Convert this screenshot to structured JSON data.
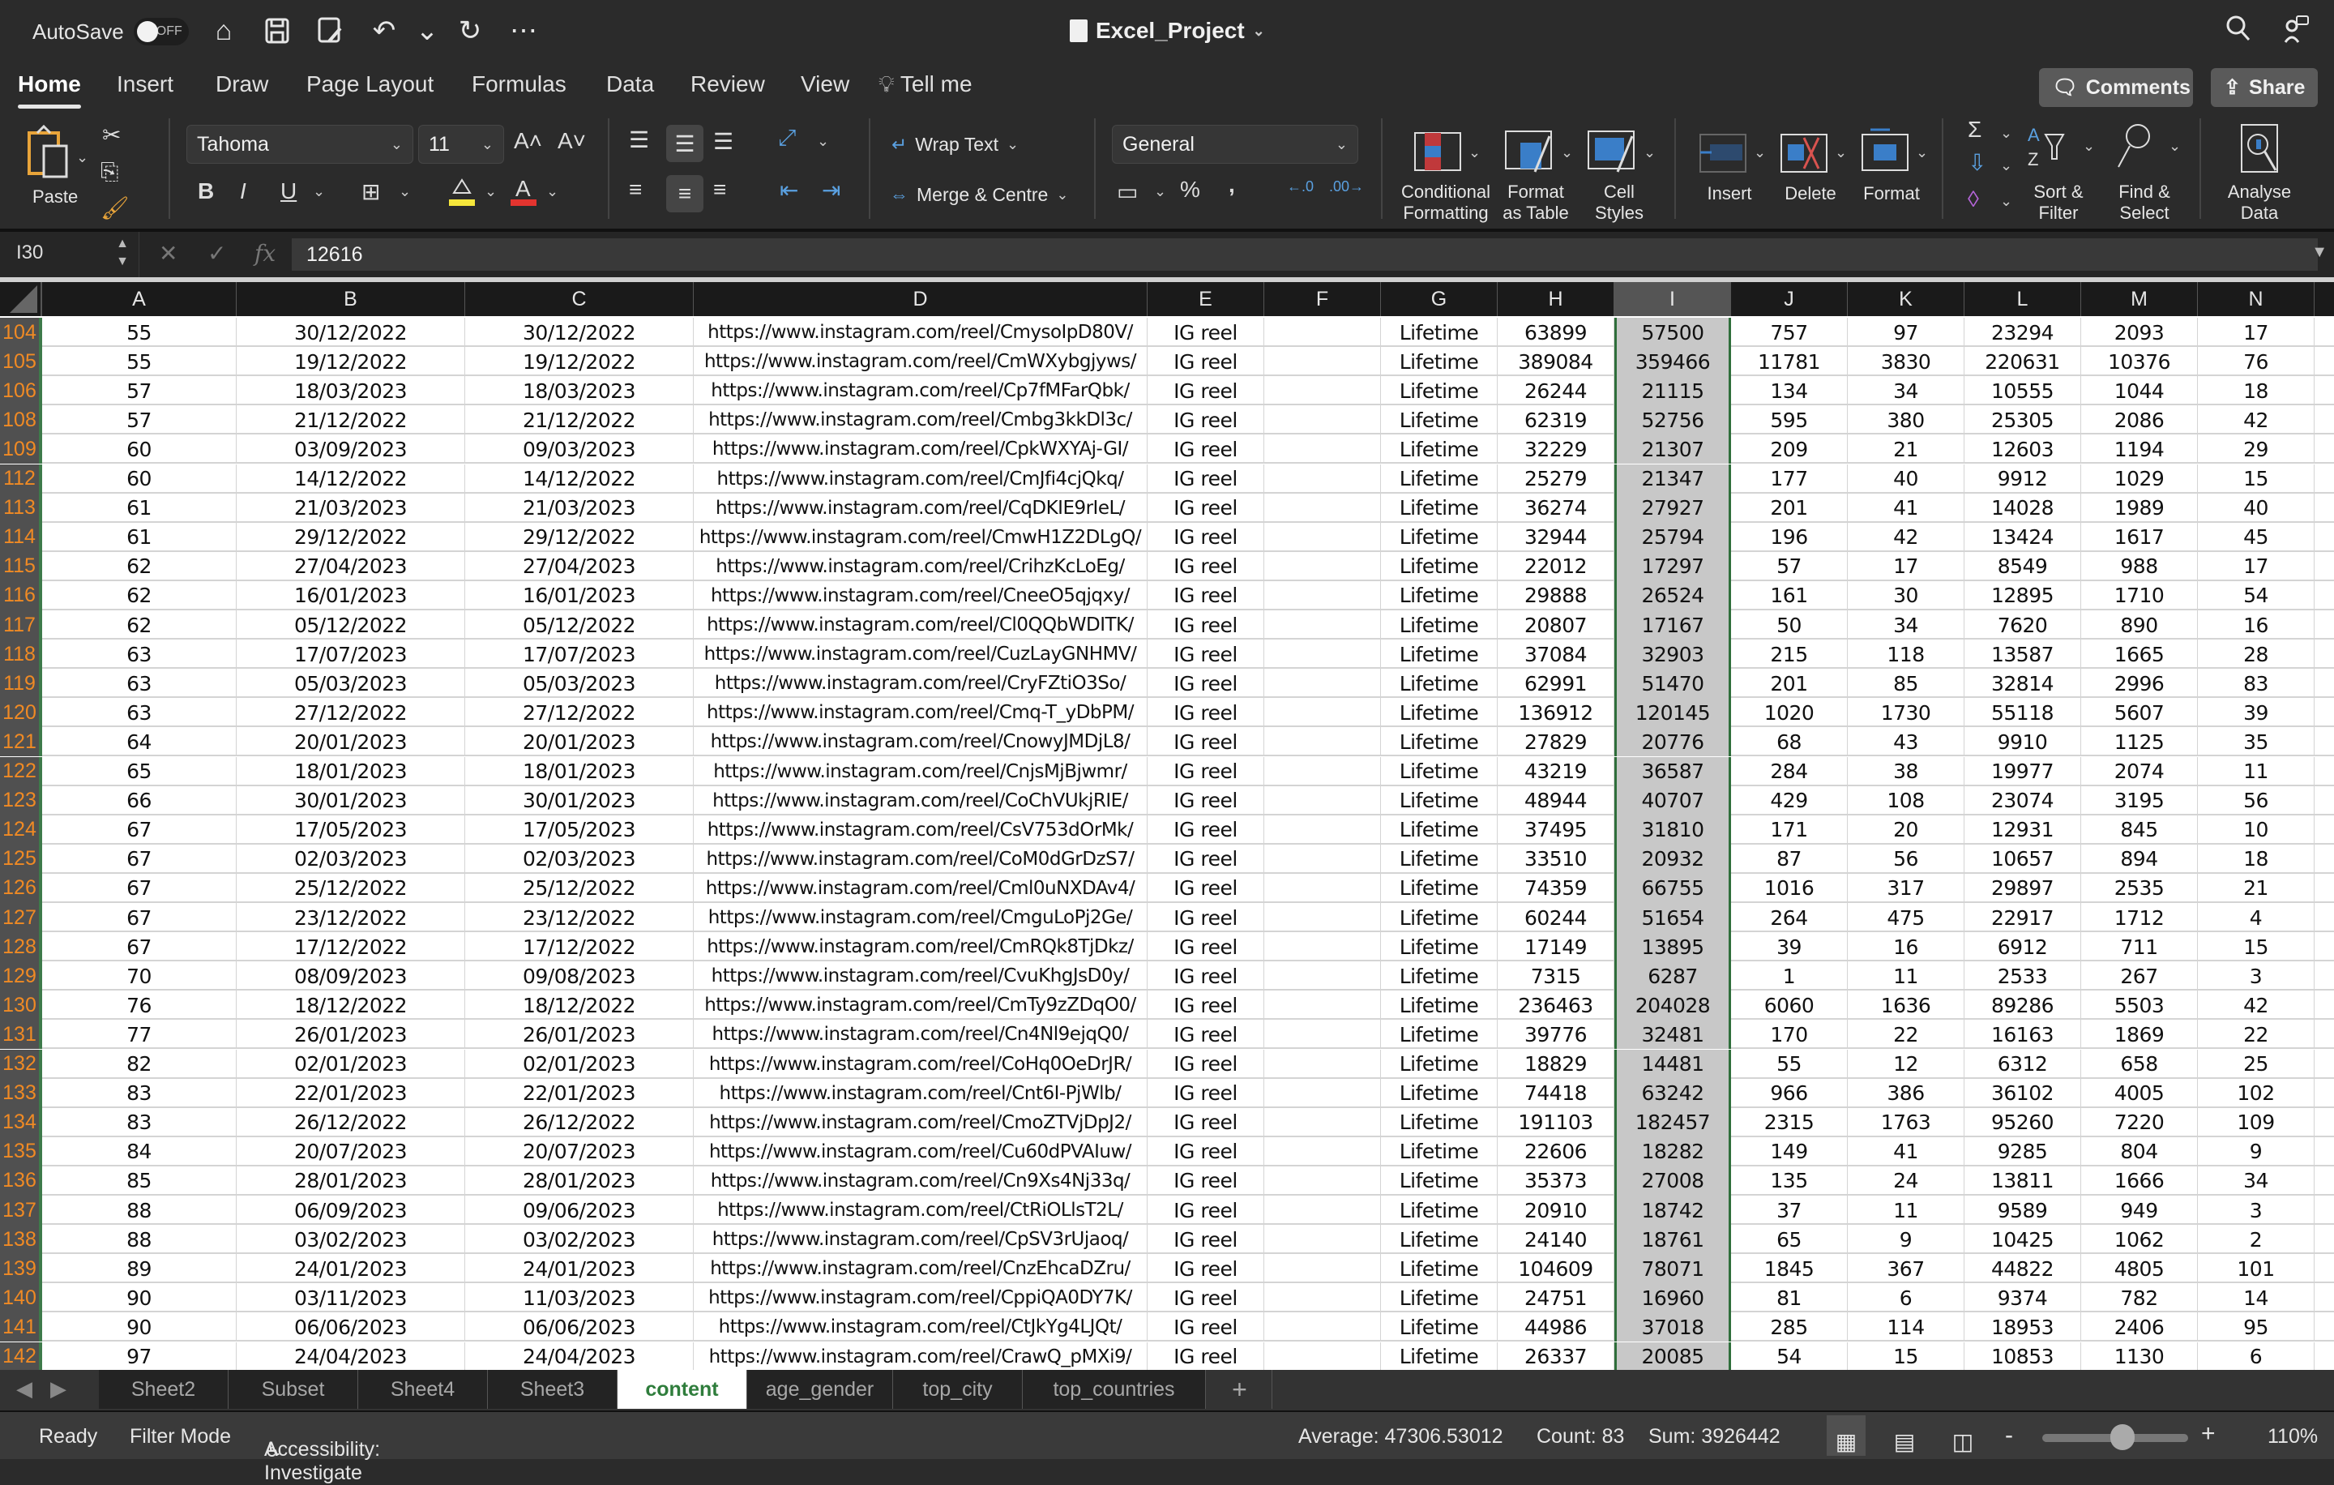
{
  "titlebar": {
    "autosave_label": "AutoSave",
    "autosave_state": "OFF",
    "doc_title": "Excel_Project",
    "qat_icons": [
      "home-icon",
      "save-icon",
      "save-as-icon",
      "undo-icon",
      "redo-icon",
      "more-icon"
    ]
  },
  "ribbon_tabs": [
    "Home",
    "Insert",
    "Draw",
    "Page Layout",
    "Formulas",
    "Data",
    "Review",
    "View"
  ],
  "tell_me": "Tell me",
  "comments_label": "Comments",
  "share_label": "Share",
  "ribbon": {
    "paste_label": "Paste",
    "font_name": "Tahoma",
    "font_size": "11",
    "wrap_text": "Wrap Text",
    "merge_centre": "Merge & Centre",
    "number_format": "General",
    "conditional_formatting": "Conditional Formatting",
    "conditional_formatting_l1": "Conditional",
    "conditional_formatting_l2": "Formatting",
    "format_as_table_l1": "Format",
    "format_as_table_l2": "as Table",
    "cell_styles_l1": "Cell",
    "cell_styles_l2": "Styles",
    "insert": "Insert",
    "delete": "Delete",
    "format": "Format",
    "sort_filter_l1": "Sort &",
    "sort_filter_l2": "Filter",
    "find_select_l1": "Find &",
    "find_select_l2": "Select",
    "analyse_data_l1": "Analyse",
    "analyse_data_l2": "Data",
    "bold": "B",
    "italic": "I",
    "underline": "U",
    "percent": "%",
    "comma": ","
  },
  "formula_bar": {
    "name_box": "I30",
    "formula": "12616"
  },
  "columns": [
    "A",
    "B",
    "C",
    "D",
    "E",
    "F",
    "G",
    "H",
    "I",
    "J",
    "K",
    "L",
    "M",
    "N"
  ],
  "selected_column": "I",
  "rows": [
    {
      "n": "104",
      "c": [
        "55",
        "30/12/2022",
        "30/12/2022",
        "https://www.instagram.com/reel/CmysoIpD80V/",
        "IG reel",
        "",
        "Lifetime",
        "63899",
        "57500",
        "757",
        "97",
        "23294",
        "2093",
        "17"
      ]
    },
    {
      "n": "105",
      "c": [
        "55",
        "19/12/2022",
        "19/12/2022",
        "https://www.instagram.com/reel/CmWXybgjyws/",
        "IG reel",
        "",
        "Lifetime",
        "389084",
        "359466",
        "11781",
        "3830",
        "220631",
        "10376",
        "76"
      ]
    },
    {
      "n": "106",
      "c": [
        "57",
        "18/03/2023",
        "18/03/2023",
        "https://www.instagram.com/reel/Cp7fMFarQbk/",
        "IG reel",
        "",
        "Lifetime",
        "26244",
        "21115",
        "134",
        "34",
        "10555",
        "1044",
        "18"
      ]
    },
    {
      "n": "108",
      "c": [
        "57",
        "21/12/2022",
        "21/12/2022",
        "https://www.instagram.com/reel/Cmbg3kkDl3c/",
        "IG reel",
        "",
        "Lifetime",
        "62319",
        "52756",
        "595",
        "380",
        "25305",
        "2086",
        "42"
      ]
    },
    {
      "n": "109",
      "c": [
        "60",
        "03/09/2023",
        "09/03/2023",
        "https://www.instagram.com/reel/CpkWXYAj-GI/",
        "IG reel",
        "",
        "Lifetime",
        "32229",
        "21307",
        "209",
        "21",
        "12603",
        "1194",
        "29"
      ]
    },
    {
      "n": "112",
      "c": [
        "60",
        "14/12/2022",
        "14/12/2022",
        "https://www.instagram.com/reel/CmJfi4cjQkq/",
        "IG reel",
        "",
        "Lifetime",
        "25279",
        "21347",
        "177",
        "40",
        "9912",
        "1029",
        "15"
      ]
    },
    {
      "n": "113",
      "c": [
        "61",
        "21/03/2023",
        "21/03/2023",
        "https://www.instagram.com/reel/CqDKIE9rIeL/",
        "IG reel",
        "",
        "Lifetime",
        "36274",
        "27927",
        "201",
        "41",
        "14028",
        "1989",
        "40"
      ]
    },
    {
      "n": "114",
      "c": [
        "61",
        "29/12/2022",
        "29/12/2022",
        "https://www.instagram.com/reel/CmwH1Z2DLgQ/",
        "IG reel",
        "",
        "Lifetime",
        "32944",
        "25794",
        "196",
        "42",
        "13424",
        "1617",
        "45"
      ]
    },
    {
      "n": "115",
      "c": [
        "62",
        "27/04/2023",
        "27/04/2023",
        "https://www.instagram.com/reel/CrihzKcLoEg/",
        "IG reel",
        "",
        "Lifetime",
        "22012",
        "17297",
        "57",
        "17",
        "8549",
        "988",
        "17"
      ]
    },
    {
      "n": "116",
      "c": [
        "62",
        "16/01/2023",
        "16/01/2023",
        "https://www.instagram.com/reel/CneeO5qjqxy/",
        "IG reel",
        "",
        "Lifetime",
        "29888",
        "26524",
        "161",
        "30",
        "12895",
        "1710",
        "54"
      ]
    },
    {
      "n": "117",
      "c": [
        "62",
        "05/12/2022",
        "05/12/2022",
        "https://www.instagram.com/reel/Cl0QQbWDITK/",
        "IG reel",
        "",
        "Lifetime",
        "20807",
        "17167",
        "50",
        "34",
        "7620",
        "890",
        "16"
      ]
    },
    {
      "n": "118",
      "c": [
        "63",
        "17/07/2023",
        "17/07/2023",
        "https://www.instagram.com/reel/CuzLayGNHMV/",
        "IG reel",
        "",
        "Lifetime",
        "37084",
        "32903",
        "215",
        "118",
        "13587",
        "1665",
        "28"
      ]
    },
    {
      "n": "119",
      "c": [
        "63",
        "05/03/2023",
        "05/03/2023",
        "https://www.instagram.com/reel/CryFZtiO3So/",
        "IG reel",
        "",
        "Lifetime",
        "62991",
        "51470",
        "201",
        "85",
        "32814",
        "2996",
        "83"
      ]
    },
    {
      "n": "120",
      "c": [
        "63",
        "27/12/2022",
        "27/12/2022",
        "https://www.instagram.com/reel/Cmq-T_yDbPM/",
        "IG reel",
        "",
        "Lifetime",
        "136912",
        "120145",
        "1020",
        "1730",
        "55118",
        "5607",
        "39"
      ]
    },
    {
      "n": "121",
      "c": [
        "64",
        "20/01/2023",
        "20/01/2023",
        "https://www.instagram.com/reel/CnowyJMDjL8/",
        "IG reel",
        "",
        "Lifetime",
        "27829",
        "20776",
        "68",
        "43",
        "9910",
        "1125",
        "35"
      ]
    },
    {
      "n": "122",
      "c": [
        "65",
        "18/01/2023",
        "18/01/2023",
        "https://www.instagram.com/reel/CnjsMjBjwmr/",
        "IG reel",
        "",
        "Lifetime",
        "43219",
        "36587",
        "284",
        "38",
        "19977",
        "2074",
        "11"
      ]
    },
    {
      "n": "123",
      "c": [
        "66",
        "30/01/2023",
        "30/01/2023",
        "https://www.instagram.com/reel/CoChVUkjRIE/",
        "IG reel",
        "",
        "Lifetime",
        "48944",
        "40707",
        "429",
        "108",
        "23074",
        "3195",
        "56"
      ]
    },
    {
      "n": "124",
      "c": [
        "67",
        "17/05/2023",
        "17/05/2023",
        "https://www.instagram.com/reel/CsV753dOrMk/",
        "IG reel",
        "",
        "Lifetime",
        "37495",
        "31810",
        "171",
        "20",
        "12931",
        "845",
        "10"
      ]
    },
    {
      "n": "125",
      "c": [
        "67",
        "02/03/2023",
        "02/03/2023",
        "https://www.instagram.com/reel/CoM0dGrDzS7/",
        "IG reel",
        "",
        "Lifetime",
        "33510",
        "20932",
        "87",
        "56",
        "10657",
        "894",
        "18"
      ]
    },
    {
      "n": "126",
      "c": [
        "67",
        "25/12/2022",
        "25/12/2022",
        "https://www.instagram.com/reel/Cml0uNXDAv4/",
        "IG reel",
        "",
        "Lifetime",
        "74359",
        "66755",
        "1016",
        "317",
        "29897",
        "2535",
        "21"
      ]
    },
    {
      "n": "127",
      "c": [
        "67",
        "23/12/2022",
        "23/12/2022",
        "https://www.instagram.com/reel/CmguLoPj2Ge/",
        "IG reel",
        "",
        "Lifetime",
        "60244",
        "51654",
        "264",
        "475",
        "22917",
        "1712",
        "4"
      ]
    },
    {
      "n": "128",
      "c": [
        "67",
        "17/12/2022",
        "17/12/2022",
        "https://www.instagram.com/reel/CmRQk8TjDkz/",
        "IG reel",
        "",
        "Lifetime",
        "17149",
        "13895",
        "39",
        "16",
        "6912",
        "711",
        "15"
      ]
    },
    {
      "n": "129",
      "c": [
        "70",
        "08/09/2023",
        "09/08/2023",
        "https://www.instagram.com/reel/CvuKhgJsD0y/",
        "IG reel",
        "",
        "Lifetime",
        "7315",
        "6287",
        "1",
        "11",
        "2533",
        "267",
        "3"
      ]
    },
    {
      "n": "130",
      "c": [
        "76",
        "18/12/2022",
        "18/12/2022",
        "https://www.instagram.com/reel/CmTy9zZDqO0/",
        "IG reel",
        "",
        "Lifetime",
        "236463",
        "204028",
        "6060",
        "1636",
        "89286",
        "5503",
        "42"
      ]
    },
    {
      "n": "131",
      "c": [
        "77",
        "26/01/2023",
        "26/01/2023",
        "https://www.instagram.com/reel/Cn4Nl9ejqQ0/",
        "IG reel",
        "",
        "Lifetime",
        "39776",
        "32481",
        "170",
        "22",
        "16163",
        "1869",
        "22"
      ]
    },
    {
      "n": "132",
      "c": [
        "82",
        "02/01/2023",
        "02/01/2023",
        "https://www.instagram.com/reel/CoHq0OeDrJR/",
        "IG reel",
        "",
        "Lifetime",
        "18829",
        "14481",
        "55",
        "12",
        "6312",
        "658",
        "25"
      ]
    },
    {
      "n": "133",
      "c": [
        "83",
        "22/01/2023",
        "22/01/2023",
        "https://www.instagram.com/reel/Cnt6I-PjWlb/",
        "IG reel",
        "",
        "Lifetime",
        "74418",
        "63242",
        "966",
        "386",
        "36102",
        "4005",
        "102"
      ]
    },
    {
      "n": "134",
      "c": [
        "83",
        "26/12/2022",
        "26/12/2022",
        "https://www.instagram.com/reel/CmoZTVjDpJ2/",
        "IG reel",
        "",
        "Lifetime",
        "191103",
        "182457",
        "2315",
        "1763",
        "95260",
        "7220",
        "109"
      ]
    },
    {
      "n": "135",
      "c": [
        "84",
        "20/07/2023",
        "20/07/2023",
        "https://www.instagram.com/reel/Cu60dPVAIuw/",
        "IG reel",
        "",
        "Lifetime",
        "22606",
        "18282",
        "149",
        "41",
        "9285",
        "804",
        "9"
      ]
    },
    {
      "n": "136",
      "c": [
        "85",
        "28/01/2023",
        "28/01/2023",
        "https://www.instagram.com/reel/Cn9Xs4Nj33q/",
        "IG reel",
        "",
        "Lifetime",
        "35373",
        "27008",
        "135",
        "24",
        "13811",
        "1666",
        "34"
      ]
    },
    {
      "n": "137",
      "c": [
        "88",
        "06/09/2023",
        "09/06/2023",
        "https://www.instagram.com/reel/CtRiOLlsT2L/",
        "IG reel",
        "",
        "Lifetime",
        "20910",
        "18742",
        "37",
        "11",
        "9589",
        "949",
        "3"
      ]
    },
    {
      "n": "138",
      "c": [
        "88",
        "03/02/2023",
        "03/02/2023",
        "https://www.instagram.com/reel/CpSV3rUjaoq/",
        "IG reel",
        "",
        "Lifetime",
        "24140",
        "18761",
        "65",
        "9",
        "10425",
        "1062",
        "2"
      ]
    },
    {
      "n": "139",
      "c": [
        "89",
        "24/01/2023",
        "24/01/2023",
        "https://www.instagram.com/reel/CnzEhcaDZru/",
        "IG reel",
        "",
        "Lifetime",
        "104609",
        "78071",
        "1845",
        "367",
        "44822",
        "4805",
        "101"
      ]
    },
    {
      "n": "140",
      "c": [
        "90",
        "03/11/2023",
        "11/03/2023",
        "https://www.instagram.com/reel/CppiQA0DY7K/",
        "IG reel",
        "",
        "Lifetime",
        "24751",
        "16960",
        "81",
        "6",
        "9374",
        "782",
        "14"
      ]
    },
    {
      "n": "141",
      "c": [
        "90",
        "06/06/2023",
        "06/06/2023",
        "https://www.instagram.com/reel/CtJkYg4LJQt/",
        "IG reel",
        "",
        "Lifetime",
        "44986",
        "37018",
        "285",
        "114",
        "18953",
        "2406",
        "95"
      ]
    },
    {
      "n": "142",
      "c": [
        "97",
        "24/04/2023",
        "24/04/2023",
        "https://www.instagram.com/reel/CrawQ_pMXi9/",
        "IG reel",
        "",
        "Lifetime",
        "26337",
        "20085",
        "54",
        "15",
        "10853",
        "1130",
        "6"
      ]
    }
  ],
  "sheet_tabs": [
    "Sheet2",
    "Subset",
    "Sheet4",
    "Sheet3",
    "content",
    "age_gender",
    "top_city",
    "top_countries"
  ],
  "active_sheet": "content",
  "add_sheet": "+",
  "status": {
    "ready": "Ready",
    "filter_mode": "Filter Mode",
    "accessibility": "Accessibility: Investigate",
    "average": "Average: 47306.53012",
    "count": "Count: 83",
    "sum": "Sum: 3926442",
    "zoom_level": "110%",
    "zoom_minus": "-",
    "zoom_plus": "+",
    "zoom_fraction": 0.55
  },
  "colors": {
    "accent_green": "#2f7d3c",
    "row_number_orange": "#f08a24",
    "selected_cell_gray": "#c8c8c8"
  }
}
